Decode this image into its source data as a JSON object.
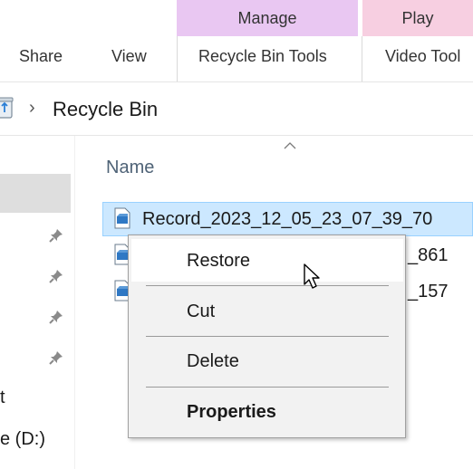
{
  "ribbon": {
    "contextual_tabs": {
      "manage": "Manage",
      "play": "Play"
    },
    "tabs": {
      "share": "Share",
      "view": "View",
      "recycle_bin_tools": "Recycle Bin Tools",
      "video_tools": "Video Tool"
    }
  },
  "address_bar": {
    "location": "Recycle Bin",
    "separator": "›"
  },
  "nav_pane": {
    "items": [
      "t",
      "e (D:)"
    ]
  },
  "file_list": {
    "column_header": "Name",
    "rows": [
      {
        "name": "Record_2023_12_05_23_07_39_70",
        "selected": true
      },
      {
        "name_suffix": "_861"
      },
      {
        "name_suffix": "_157"
      }
    ]
  },
  "context_menu": {
    "items": [
      "Restore",
      "Cut",
      "Delete",
      "Properties"
    ],
    "hovered_item": "Restore"
  },
  "colors": {
    "manage_tab": "#e9c7f2",
    "play_tab": "#f7cfe1",
    "selection_fill": "#cce8ff",
    "menu_background": "#f2f2f2"
  }
}
